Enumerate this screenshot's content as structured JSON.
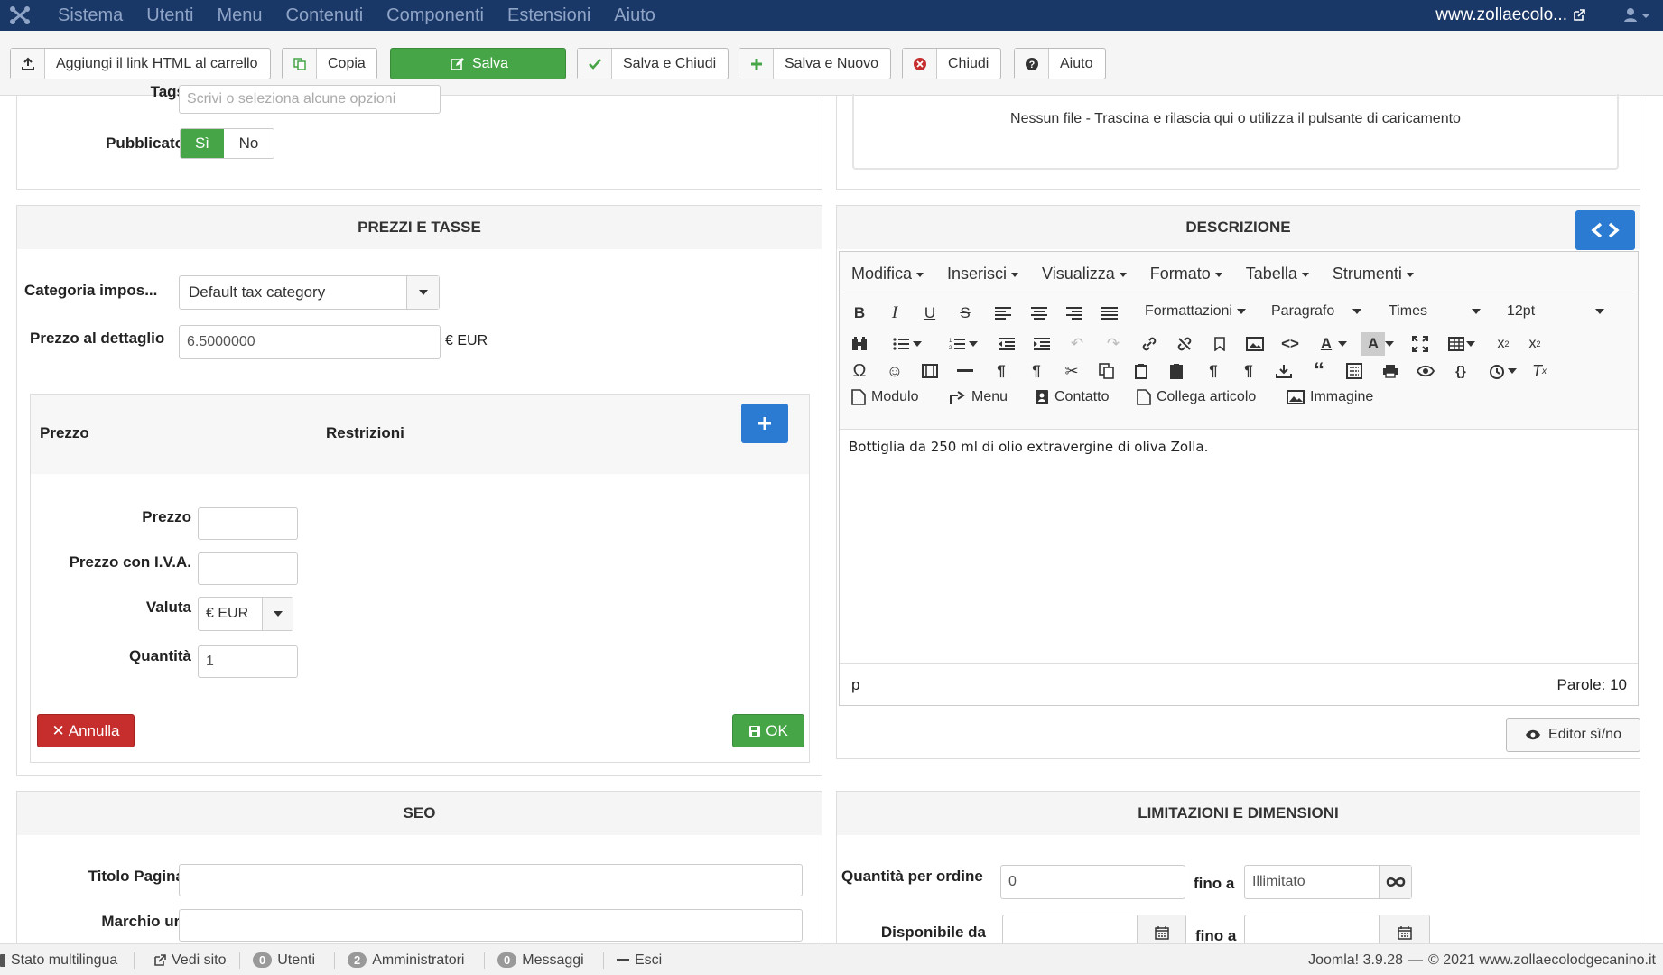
{
  "topnav": {
    "menu": [
      "Sistema",
      "Utenti",
      "Menu",
      "Contenuti",
      "Componenti",
      "Estensioni",
      "Aiuto"
    ],
    "site": "www.zollaecolo..."
  },
  "toolbar": {
    "add_html_link": "Aggiungi il link HTML al carrello",
    "copy": "Copia",
    "save": "Salva",
    "save_close": "Salva e Chiudi",
    "save_new": "Salva e Nuovo",
    "close": "Chiudi",
    "help": "Aiuto"
  },
  "top_left": {
    "tags_label": "Tags",
    "tags_placeholder": "Scrivi o seleziona alcune opzioni",
    "published_label": "Pubblicato",
    "yes": "Sì",
    "no": "No"
  },
  "top_right": {
    "dropzone_text": "Nessun file - Trascina e rilascia qui o utilizza il pulsante di caricamento"
  },
  "prices": {
    "title": "PREZZI E TASSE",
    "tax_category_label": "Categoria impos...",
    "tax_category_value": "Default tax category",
    "retail_price_label": "Prezzo al dettaglio",
    "retail_price_value": "6.5000000",
    "currency_suffix": "€ EUR",
    "col_price": "Prezzo",
    "col_restrictions": "Restrizioni",
    "price_label": "Prezzo",
    "price_vat_label": "Prezzo con I.V.A.",
    "currency_label": "Valuta",
    "currency_value": "€ EUR",
    "quantity_label": "Quantità",
    "quantity_value": "1",
    "cancel": "Annulla",
    "ok": "OK"
  },
  "description": {
    "title": "DESCRIZIONE",
    "menus": [
      "Modifica",
      "Inserisci",
      "Visualizza",
      "Formato",
      "Tabella",
      "Strumenti"
    ],
    "formats_dropdown": "Formattazioni",
    "block_dropdown": "Paragrafo",
    "font_dropdown": "Times",
    "size_dropdown": "12pt",
    "plugins": [
      "Modulo",
      "Menu",
      "Contatto",
      "Collega articolo",
      "Immagine"
    ],
    "content": "Bottiglia da 250 ml di olio extravergine di oliva Zolla.",
    "path": "p",
    "word_count": "Parole: 10",
    "toggle_editor": "Editor sì/no"
  },
  "seo": {
    "title": "SEO",
    "page_title_label": "Titolo Pagina",
    "url_label": "Marchio url"
  },
  "limits": {
    "title": "LIMITAZIONI E DIMENSIONI",
    "qty_per_order_label": "Quantità per ordine",
    "qty_min_value": "0",
    "to_label": "fino a",
    "qty_max_placeholder": "Illimitato",
    "available_from_label": "Disponibile da",
    "to_label2": "fino a"
  },
  "statusbar": {
    "multilang": "Stato multilingua",
    "view_site": "Vedi sito",
    "users_count": "0",
    "users": "Utenti",
    "admins_count": "2",
    "admins": "Amministratori",
    "messages_count": "0",
    "messages": "Messaggi",
    "logout": "Esci",
    "version": "Joomla! 3.9.28",
    "copyright": "© 2021 www.zollaecolodgecanino.it"
  },
  "colors": {
    "nav": "#1a3867",
    "green": "#46a546",
    "blue": "#2a7bd1",
    "red": "#c62d2d"
  }
}
